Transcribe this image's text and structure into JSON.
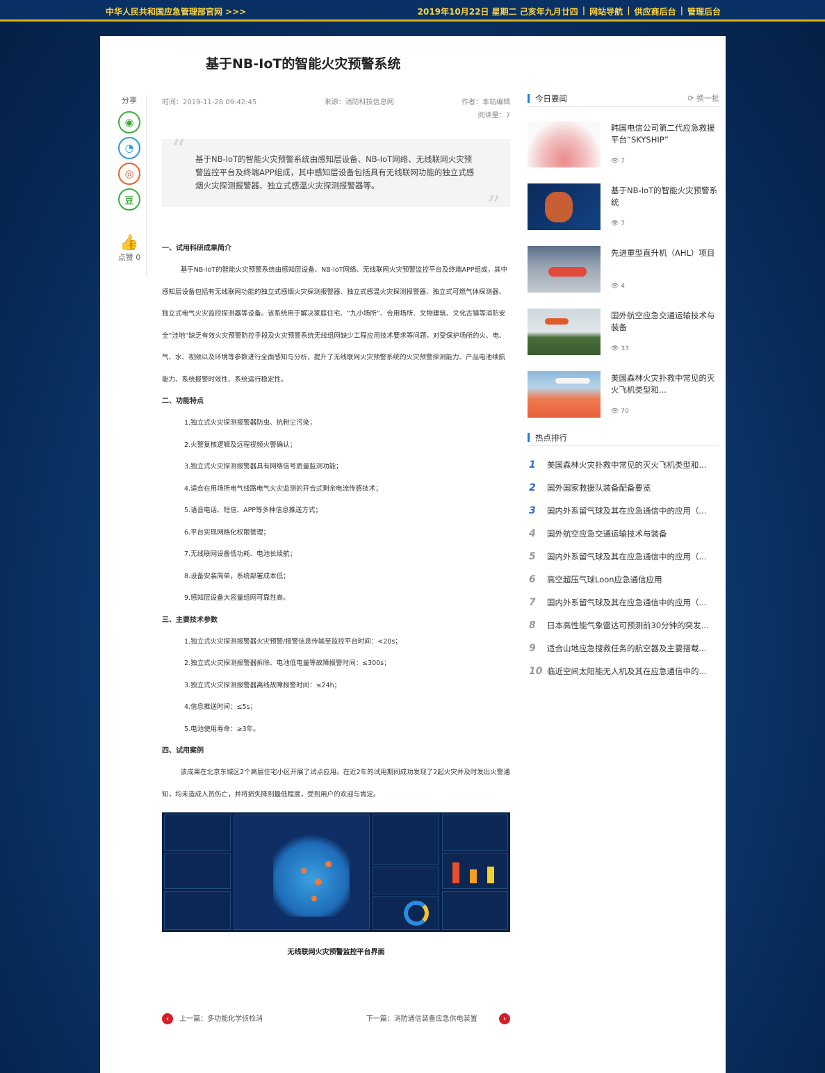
{
  "topbar": {
    "site_name": "中华人民共和国应急管理部官网 >>>",
    "date": "2019年10月22日 星期二 己亥年九月廿四",
    "links": [
      "网站导航",
      "供应商后台",
      "管理后台"
    ]
  },
  "article": {
    "title": "基于NB-IoT的智能火灾预警系统",
    "time": "时间：2019-11-28 09:42:45",
    "source": "来源：消防科技信息网",
    "author": "作者：本站编辑",
    "reads": "阅读量：7",
    "summary": "基于NB-IoT的智能火灾预警系统由感知层设备、NB-IoT网络、无线联网火灾预警监控平台及终端APP组成，其中感知层设备包括具有无线联网功能的独立式感烟火灾探测报警器、独立式感温火灾探测报警器等。",
    "sections": [
      {
        "heading": "一、试用科研成果简介",
        "para": "基于NB-IoT的智能火灾预警系统由感知层设备、NB-IoT网络、无线联网火灾预警监控平台及终端APP组成，其中感知层设备包括有无线联网功能的独立式感烟火灾探测报警器、独立式感温火灾探测报警器、独立式可燃气体探测器、独立式电气火灾监控探测器等设备。该系统用于解决家庭住宅、“九小场所”、合用场所、文物建筑、文化古镇等消防安全“洼地”缺乏有效火灾预警防控手段及火灾预警系统无线组网缺少工程应用技术要求等问题，对受保护场所的火、电、气、水、视频以及环境等参数进行全面感知与分析，提升了无线联网火灾预警系统的火灾预警探测能力、产品电池续航能力、系统报警时效性、系统运行稳定性。"
      },
      {
        "heading": "二、功能特点",
        "items": [
          "1.独立式火灾探测报警器防虫、抗粉尘污染；",
          "2.火警复核逻辑及远程视频火警确认；",
          "3.独立式火灾探测报警器具有网络信号质量监测功能；",
          "4.适合在用场所电气线路电气火灾监测的开合式剩余电流传感技术；",
          "5.语音电话、短信、APP等多种信息推送方式；",
          "6.平台实现网格化权限管理；",
          "7.无线联网设备低功耗、电池长续航；",
          "8.设备安装简单，系统部署成本低；",
          "9.感知层设备大容量组网可靠性高。"
        ]
      },
      {
        "heading": "三、主要技术参数",
        "items": [
          "1.独立式火灾探测报警器火灾预警/报警信息传输至监控平台时间：<20s；",
          "2.独立式火灾探测报警器拆除、电池低电量等故障报警时间：≤300s；",
          "3.独立式火灾探测报警器离线故障报警时间：≤24h；",
          "4.信息推送时间：≤5s；",
          "5.电池使用寿命：≥3年。"
        ]
      },
      {
        "heading": "四、试用案例",
        "para": "该成果在北京东城区2个高层住宅小区开展了试点应用。在近2年的试用期间成功发现了2起火灾并及时发出火警通知，均未造成人员伤亡，并将损失降到最低程度，受到用户的欢迎与肯定。"
      }
    ],
    "image_caption": "无线联网火灾预警监控平台界面",
    "prev": "上一篇：多功能化学侦检消",
    "next": "下一篇：消防通信装备应急供电装置"
  },
  "share": {
    "label": "分享",
    "buttons": [
      {
        "icon": "wechat-icon",
        "glyph": "◉",
        "color": "#3aae3a"
      },
      {
        "icon": "qq-icon",
        "glyph": "◔",
        "color": "#2a9bd8"
      },
      {
        "icon": "weibo-icon",
        "glyph": "◎",
        "color": "#e8602c"
      },
      {
        "icon": "douban-icon",
        "glyph": "豆",
        "color": "#3aae3a"
      }
    ],
    "like_label": "点赞 0"
  },
  "sidebar": {
    "today_title": "今日要闻",
    "refresh_label": "换一批",
    "news": [
      {
        "title": "韩国电信公司第二代应急救援平台“SKYSHIP”",
        "views": "7"
      },
      {
        "title": "基于NB-IoT的智能火灾预警系统",
        "views": "7"
      },
      {
        "title": "先进重型直升机（AHL）项目",
        "views": "4"
      },
      {
        "title": "国外航空应急交通运输技术与装备",
        "views": "33"
      },
      {
        "title": "美国森林火灾扑救中常见的灭火飞机类型和...",
        "views": "70"
      }
    ],
    "hot_title": "热点排行",
    "hot": [
      {
        "n": "1",
        "t": "美国森林火灾扑救中常见的灭火飞机类型和..."
      },
      {
        "n": "2",
        "t": "国外国家救援队装备配备要览"
      },
      {
        "n": "3",
        "t": "国内外系留气球及其在应急通信中的应用（..."
      },
      {
        "n": "4",
        "t": "国外航空应急交通运输技术与装备"
      },
      {
        "n": "5",
        "t": "国内外系留气球及其在应急通信中的应用（..."
      },
      {
        "n": "6",
        "t": "高空超压气球Loon应急通信应用"
      },
      {
        "n": "7",
        "t": "国内外系留气球及其在应急通信中的应用（..."
      },
      {
        "n": "8",
        "t": "日本高性能气象雷达可预测前30分钟的突发..."
      },
      {
        "n": "9",
        "t": "适合山地应急搜救任务的航空器及主要搭载..."
      },
      {
        "n": "10",
        "t": "临近空间太阳能无人机及其在应急通信中的..."
      }
    ]
  }
}
